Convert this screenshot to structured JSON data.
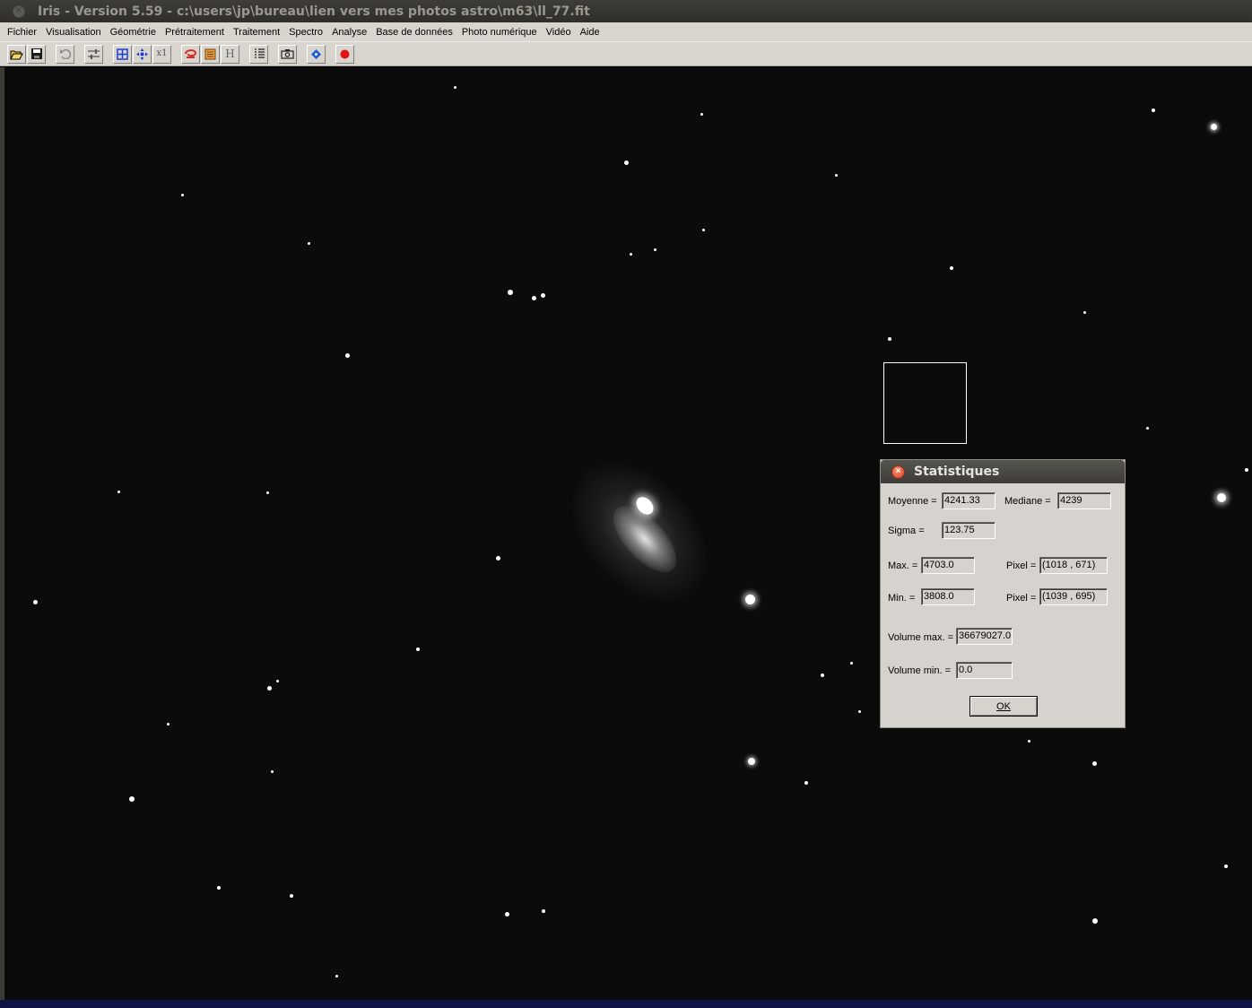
{
  "window": {
    "title": "Iris - Version 5.59 - c:\\users\\jp\\bureau\\lien vers mes photos astro\\m63\\ll_77.fit"
  },
  "menu": [
    "Fichier",
    "Visualisation",
    "Géométrie",
    "Prétraitement",
    "Traitement",
    "Spectro",
    "Analyse",
    "Base de données",
    "Photo numérique",
    "Vidéo",
    "Aide"
  ],
  "toolbar": {
    "icons": [
      "open-folder-icon",
      "save-disk-icon",
      "undo-icon",
      "threshold-sliders-icon",
      "zoom-fit-icon",
      "pan-icon",
      "zoom-x1-icon",
      "red-swirl-icon",
      "palette-icon",
      "histogram-icon",
      "command-list-icon",
      "camera-icon",
      "blue-diamond-icon",
      "record-icon"
    ],
    "x1_label": "x1",
    "h_label": "H"
  },
  "dialog": {
    "title": "Statistiques",
    "moyenne_label": "Moyenne =",
    "moyenne": "4241.33",
    "mediane_label": "Mediane =",
    "mediane": "4239",
    "sigma_label": "Sigma =",
    "sigma": "123.75",
    "max_label": "Max. =",
    "max": "4703.0",
    "max_pixel_label": "Pixel =",
    "max_pixel": "(1018 , 671)",
    "min_label": "Min. =",
    "min": "3808.0",
    "min_pixel_label": "Pixel =",
    "min_pixel": "(1039 , 695)",
    "volume_max_label": "Volume max. =",
    "volume_max": "36679027.0",
    "volume_min_label": "Volume min. =",
    "volume_min": "0.0",
    "ok_label": "OK"
  }
}
